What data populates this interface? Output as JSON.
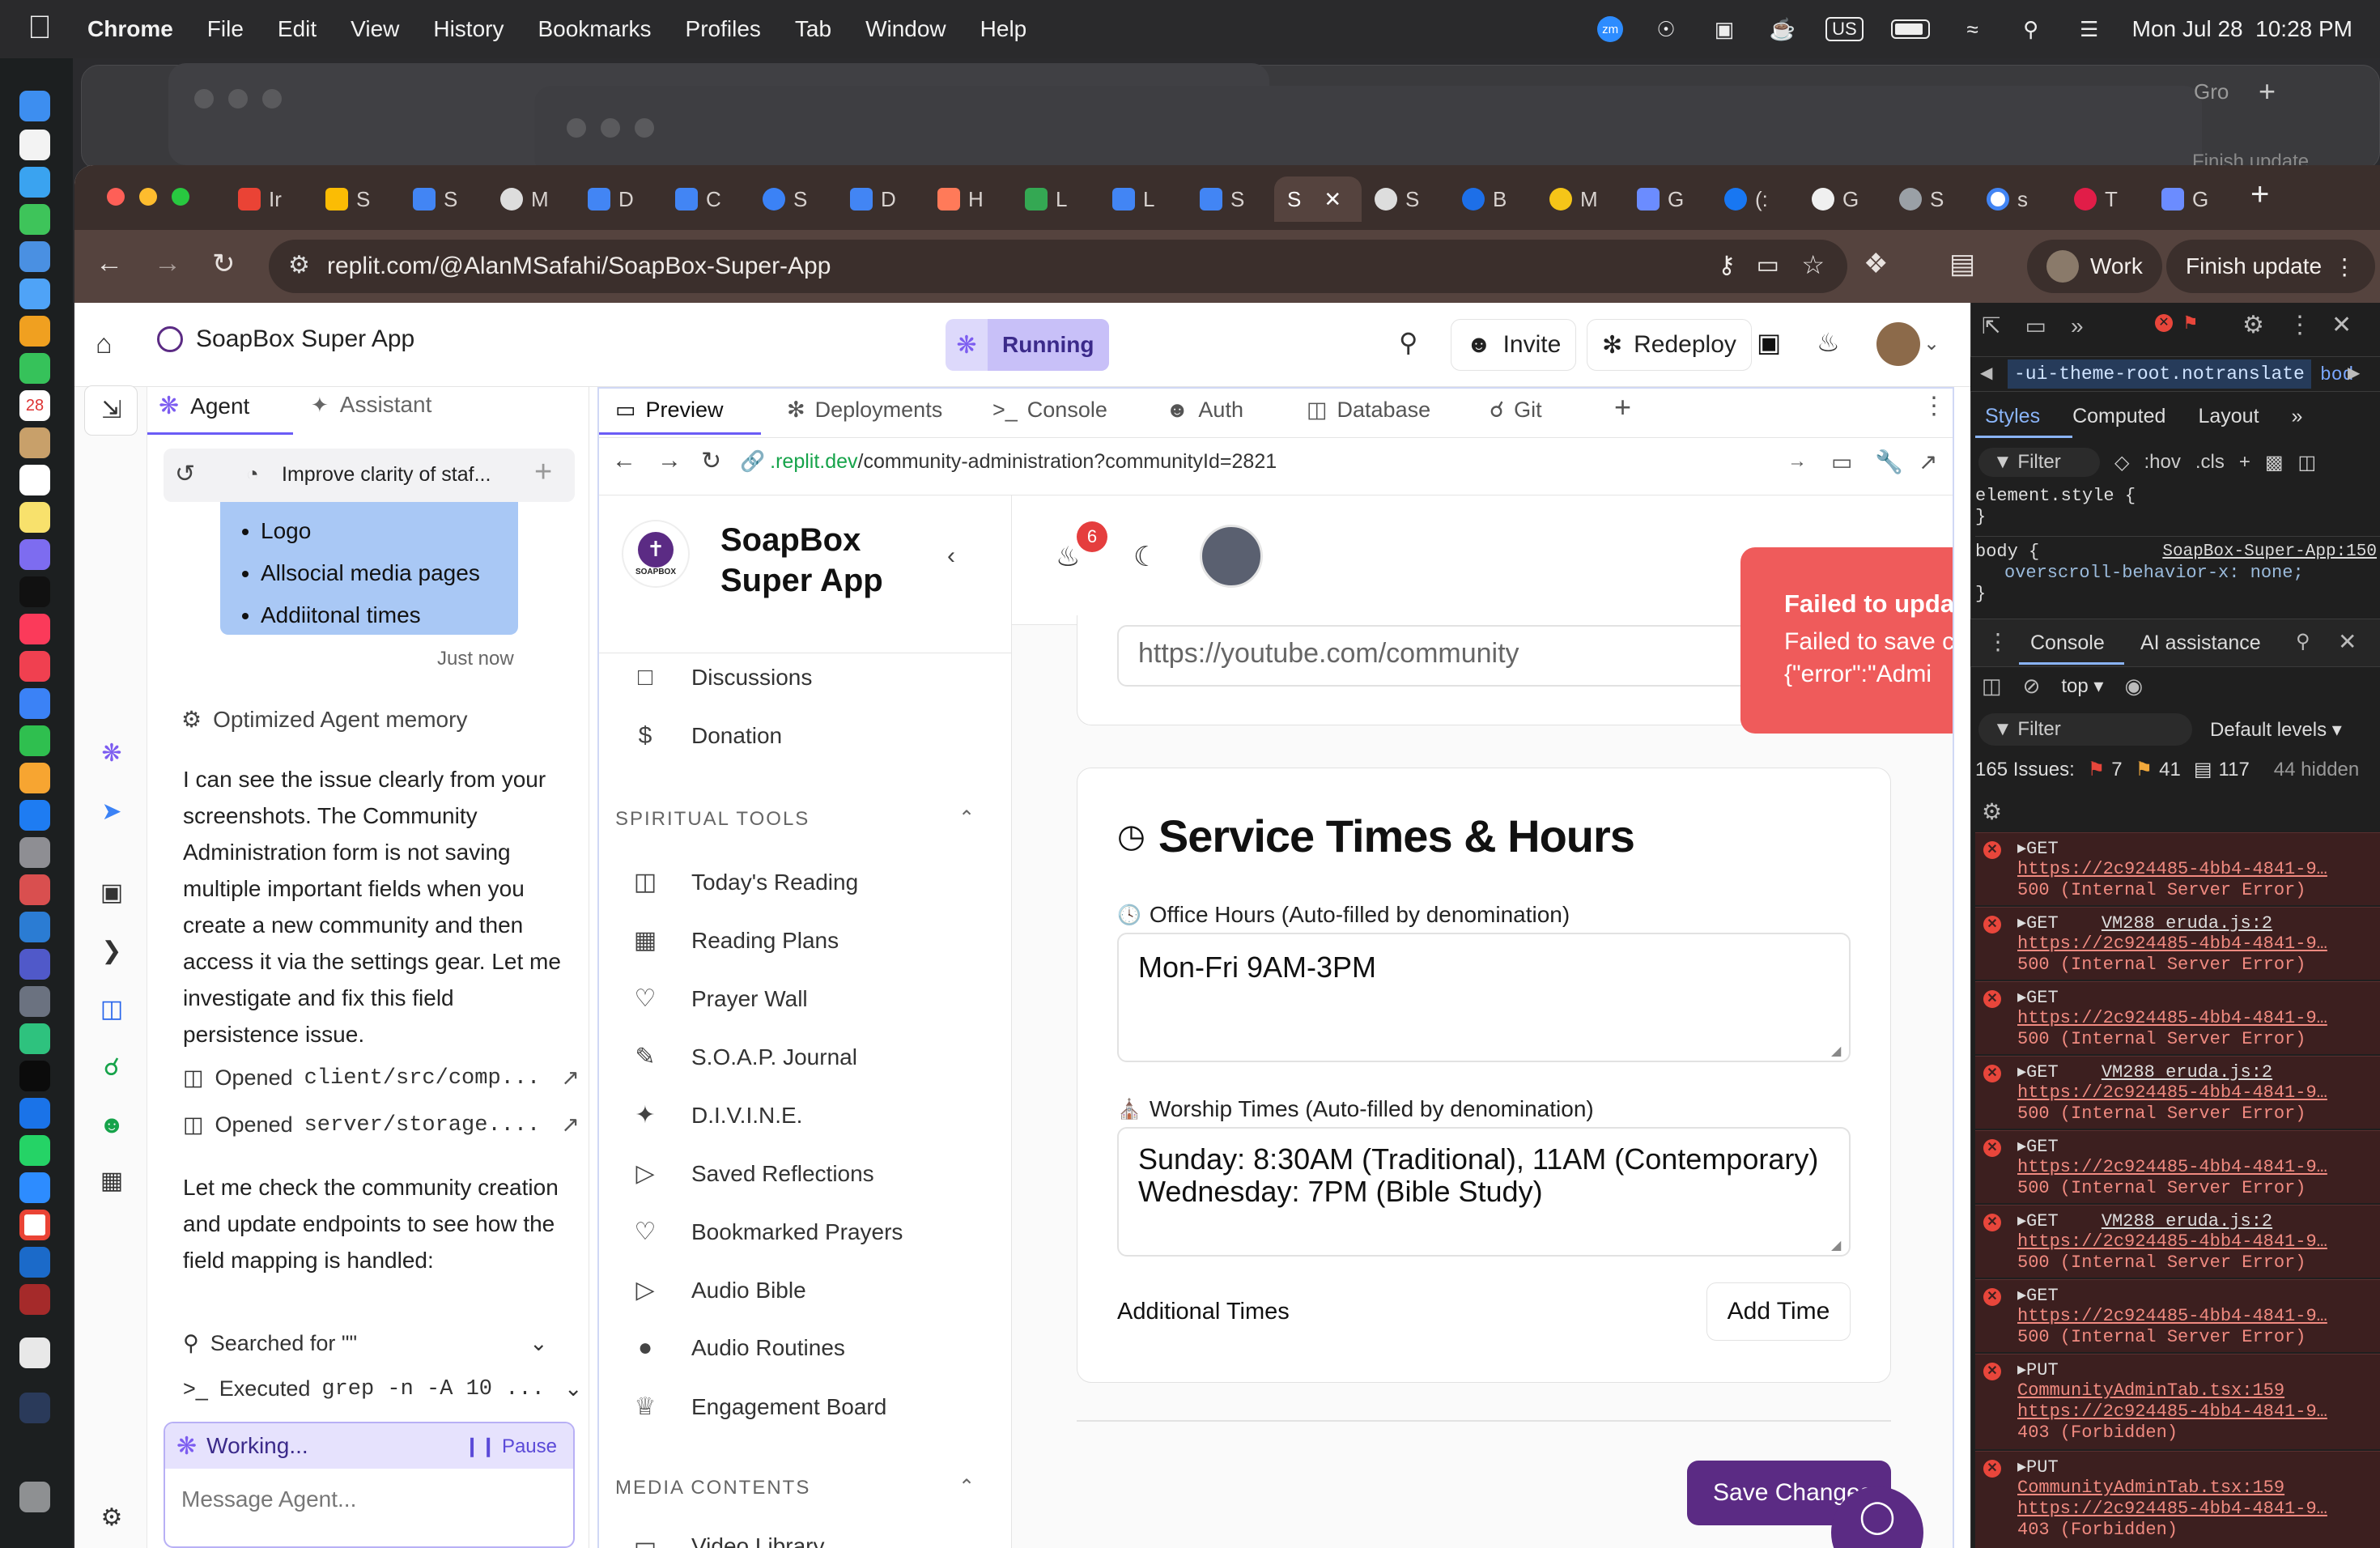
{
  "menubar": {
    "app": "Chrome",
    "items": [
      "File",
      "Edit",
      "View",
      "History",
      "Bookmarks",
      "Profiles",
      "Tab",
      "Window",
      "Help"
    ],
    "datetime": "Mon Jul 28  10:28 PM",
    "keyboard": "US",
    "zoom_badge": "zm"
  },
  "browser": {
    "tabs": [
      "Ir",
      "S",
      "S",
      "M",
      "D",
      "C",
      "S",
      "D",
      "H",
      "L",
      "L",
      "S",
      "S",
      "S",
      "B",
      "M",
      "G",
      "(:",
      "G",
      "S",
      "s",
      "T",
      "G"
    ],
    "url": "replit.com/@AlanMSafahi/SoapBox-Super-App",
    "profile_label": "Work",
    "update_label": "Finish update",
    "bg_window_label": "Finish update",
    "bg_window_tab": "Gro"
  },
  "replit": {
    "project_name": "SoapBox Super App",
    "status": "Running",
    "invite": "Invite",
    "redeploy": "Redeploy",
    "agent_tab": "Agent",
    "assistant_tab": "Assistant",
    "thread_title": "Improve clarity of staf...",
    "preview_tabs": [
      "Preview",
      "Deployments",
      "Console",
      "Auth",
      "Database",
      "Git"
    ],
    "preview_url_host": ".replit.dev",
    "preview_url_path": "/community-administration?communityId=2821"
  },
  "agent": {
    "bullets": [
      "Logo",
      "Allsocial media pages",
      "Addiitonal times"
    ],
    "timestamp": "Just now",
    "memory_note": "Optimized Agent memory",
    "message1": "I can see the issue clearly from your screenshots. The Community Administration form is not saving multiple important fields when you create a new community and then access it via the settings gear. Let me investigate and fix this field persistence issue.",
    "opened1_prefix": "Opened",
    "opened1_file": "client/src/comp...",
    "opened2_prefix": "Opened",
    "opened2_file": "server/storage....",
    "message2": "Let me check the community creation and update endpoints to see how the field mapping is handled:",
    "search_label": "Searched for \"\"",
    "exec_prefix": "Executed",
    "exec_cmd": "grep -n -A 10 ...",
    "working": "Working...",
    "pause": "Pause",
    "input_placeholder": "Message Agent..."
  },
  "app": {
    "brand": "SoapBox Super App",
    "logo_text": "SOAPBOX",
    "notif_count": "6",
    "nav_top": [
      "Discussions",
      "Donation"
    ],
    "section_spiritual": "SPIRITUAL TOOLS",
    "nav_spiritual": [
      "Today's Reading",
      "Reading Plans",
      "Prayer Wall",
      "S.O.A.P. Journal",
      "D.I.V.I.N.E.",
      "Saved Reflections",
      "Bookmarked Prayers",
      "Audio Bible",
      "Audio Routines",
      "Engagement Board"
    ],
    "section_media": "MEDIA CONTENTS",
    "nav_media": [
      "Video Library"
    ],
    "youtube_value": "https://youtube.com/community",
    "service_heading": "Service Times & Hours",
    "office_label": "Office Hours (Auto-filled by denomination)",
    "office_value": "Mon-Fri 9AM-3PM",
    "worship_label": "Worship Times (Auto-filled by denomination)",
    "worship_line1": "Sunday: 8:30AM (Traditional), 11AM (Contemporary)",
    "worship_line2": "Wednesday: 7PM (Bible Study)",
    "additional_label": "Additional Times",
    "add_time": "Add Time",
    "save_button": "Save Changes",
    "toast_title": "Failed to upda",
    "toast_line1": "Failed to save c",
    "toast_line2": "{\"error\":\"Admi"
  },
  "devtools": {
    "breadcrumb": "-ui-theme-root.notranslate",
    "breadcrumb_tail": "bod",
    "tabs": [
      "Styles",
      "Computed",
      "Layout"
    ],
    "filter": "Filter",
    "hov": ":hov",
    "cls": ".cls",
    "element_style": "element.style {",
    "close_brace": "}",
    "body_rule": "body {",
    "source": "SoapBox-Super-App:150",
    "property": "overscroll-behavior-x: none;",
    "console_tab": "Console",
    "ai_tab": "AI assistance",
    "context": "top",
    "levels": "Default levels",
    "issues_label": "165 Issues:",
    "issue_err": "7",
    "issue_warn": "41",
    "issue_info": "117",
    "hidden": "44 hidden",
    "errors": [
      {
        "method": "GET",
        "src": "",
        "url": "https://2c924485-4bb4-4841-9…",
        "status": "500 (Internal Server Error)"
      },
      {
        "method": "GET",
        "src": "VM288 eruda.js:2",
        "url": "https://2c924485-4bb4-4841-9…",
        "status": "500 (Internal Server Error)"
      },
      {
        "method": "GET",
        "src": "",
        "url": "https://2c924485-4bb4-4841-9…",
        "status": "500 (Internal Server Error)"
      },
      {
        "method": "GET",
        "src": "VM288 eruda.js:2",
        "url": "https://2c924485-4bb4-4841-9…",
        "status": "500 (Internal Server Error)"
      },
      {
        "method": "GET",
        "src": "",
        "url": "https://2c924485-4bb4-4841-9…",
        "status": "500 (Internal Server Error)"
      },
      {
        "method": "GET",
        "src": "VM288 eruda.js:2",
        "url": "https://2c924485-4bb4-4841-9…",
        "status": "500 (Internal Server Error)"
      },
      {
        "method": "GET",
        "src": "",
        "url": "https://2c924485-4bb4-4841-9…",
        "status": "500 (Internal Server Error)"
      },
      {
        "method": "PUT",
        "src": "CommunityAdminTab.tsx:159",
        "url": "https://2c924485-4bb4-4841-9…",
        "status": "403 (Forbidden)"
      },
      {
        "method": "PUT",
        "src": "CommunityAdminTab.tsx:159",
        "url": "https://2c924485-4bb4-4841-9…",
        "status": "403 (Forbidden)"
      }
    ]
  },
  "colors": {
    "accent_purple": "#5b2b84",
    "toast_red": "#ef5b5b",
    "running_bg": "#c8c4f5",
    "chrome_frame": "#55433e"
  }
}
